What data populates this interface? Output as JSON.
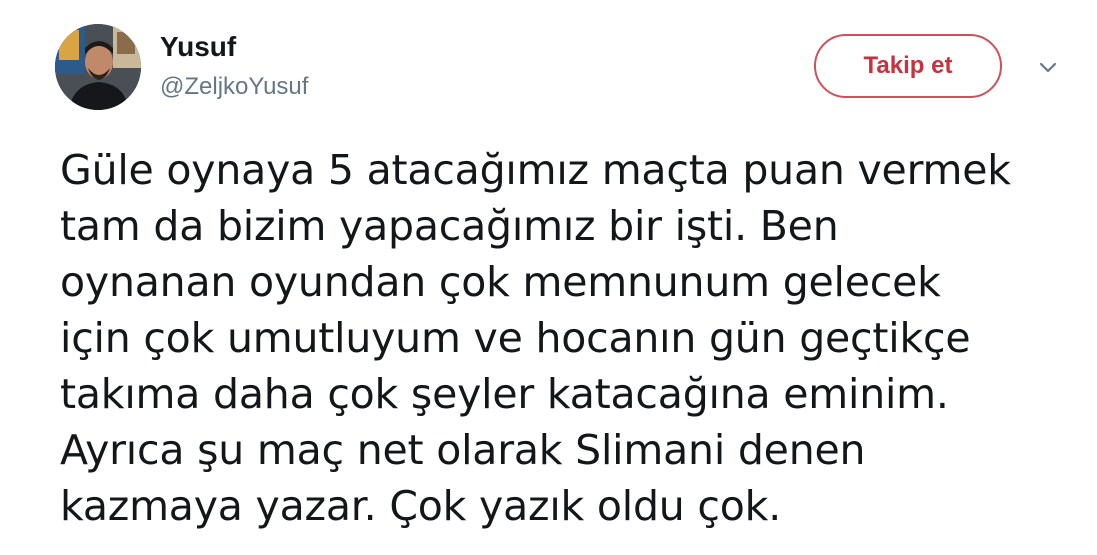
{
  "user": {
    "display_name": "Yusuf",
    "handle": "@ZeljkoYusuf"
  },
  "actions": {
    "follow_label": "Takip et",
    "menu_icon": "chevron-down-icon"
  },
  "tweet": {
    "lines": [
      "Güle oynaya 5 atacağımız maçta puan vermek",
      "tam da bizim yapacağımız bir işti. Ben",
      "oynanan oyundan çok memnunum gelecek",
      "için çok umutluyum ve hocanın gün geçtikçe",
      "takıma daha çok şeyler katacağına eminim.",
      "Ayrıca şu maç net olarak Slimani denen",
      "kazmaya yazar. Çok yazık oldu çok."
    ]
  },
  "colors": {
    "follow_accent": "#c8313d",
    "handle_gray": "#657786",
    "text": "#14171a"
  }
}
